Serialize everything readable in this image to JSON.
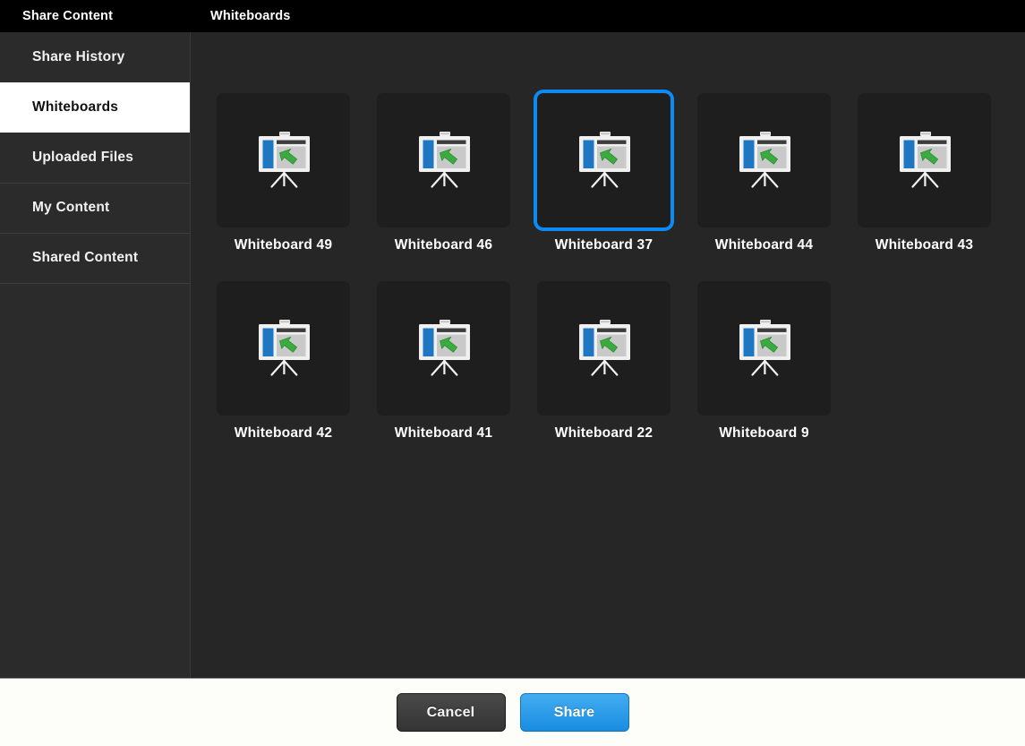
{
  "titlebar": {
    "app_title": "Share Content",
    "section_title": "Whiteboards"
  },
  "sidebar": {
    "items": [
      {
        "label": "Share History",
        "selected": false
      },
      {
        "label": "Whiteboards",
        "selected": true
      },
      {
        "label": "Uploaded Files",
        "selected": false
      },
      {
        "label": "My Content",
        "selected": false
      },
      {
        "label": "Shared Content",
        "selected": false
      }
    ]
  },
  "main": {
    "icon_name": "presentation-easel-icon",
    "items": [
      {
        "label": "Whiteboard 49",
        "selected": false
      },
      {
        "label": "Whiteboard 46",
        "selected": false
      },
      {
        "label": "Whiteboard 37",
        "selected": true
      },
      {
        "label": "Whiteboard 44",
        "selected": false
      },
      {
        "label": "Whiteboard 43",
        "selected": false
      },
      {
        "label": "Whiteboard 42",
        "selected": false
      },
      {
        "label": "Whiteboard 41",
        "selected": false
      },
      {
        "label": "Whiteboard 22",
        "selected": false
      },
      {
        "label": "Whiteboard 9",
        "selected": false
      }
    ]
  },
  "footer": {
    "cancel_label": "Cancel",
    "share_label": "Share"
  },
  "colors": {
    "selection_blue": "#0d8bf2",
    "share_button_blue": "#1a8de2",
    "window_background": "#262626",
    "tile_background": "#1e1e1e",
    "sidebar_background": "#2b2b2b",
    "titlebar_background": "#000000",
    "footer_background": "#fdfdfa",
    "icon_blue": "#1f77c4",
    "icon_green": "#3aab3f"
  }
}
